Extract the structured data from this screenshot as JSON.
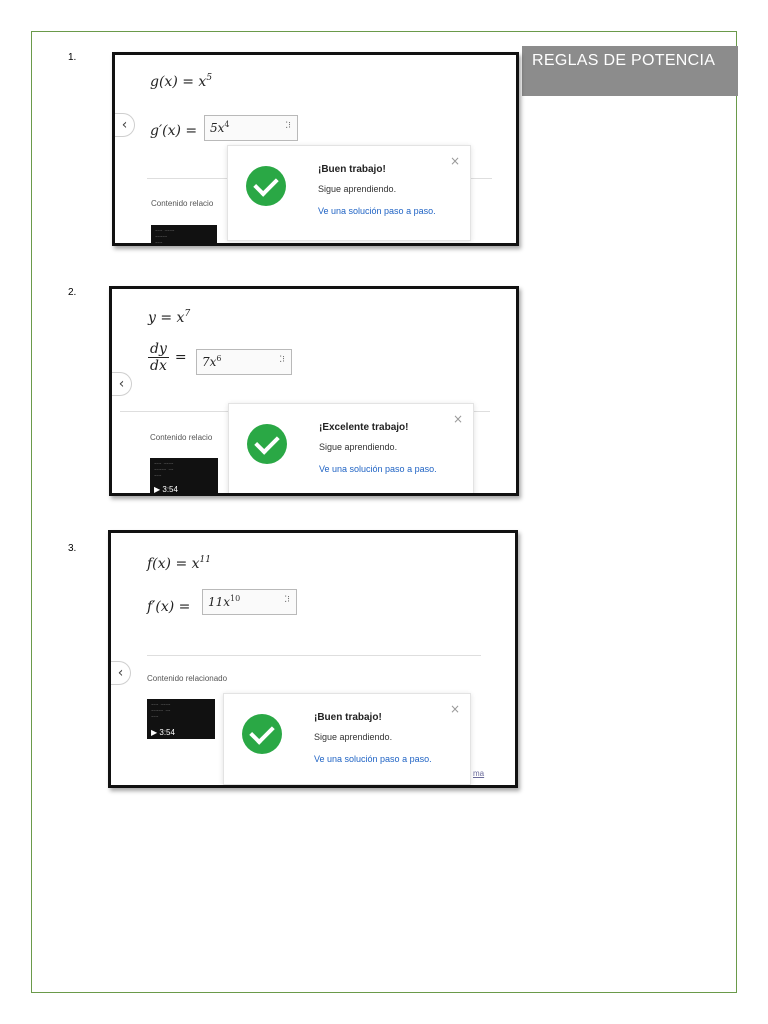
{
  "title": "REGLAS DE POTENCIA",
  "exercises": [
    {
      "number": "1.",
      "function": "g(x) = x",
      "function_exp": "5",
      "derivative_label": "g′(x) =",
      "answer_base": "5x",
      "answer_exp": "4",
      "related": "Contenido relacio",
      "video_duration": "",
      "toast": {
        "title": "¡Buen trabajo!",
        "subtitle": "Sigue aprendiendo.",
        "link": "Ve una solución paso a paso."
      }
    },
    {
      "number": "2.",
      "function": "y = x",
      "function_exp": "7",
      "deriv_num": "dy",
      "deriv_den": "dx",
      "derivative_label": "=",
      "answer_base": "7x",
      "answer_exp": "6",
      "related": "Contenido relacio",
      "video_duration": "▶ 3:54",
      "toast": {
        "title": "¡Excelente trabajo!",
        "subtitle": "Sigue aprendiendo.",
        "link": "Ve una solución paso a paso."
      }
    },
    {
      "number": "3.",
      "function": "f(x) = x",
      "function_exp": "11",
      "derivative_label": "f′(x) =",
      "answer_base": "11x",
      "answer_exp": "10",
      "related": "Contenido relacionado",
      "video_duration": "▶ 3:54",
      "trailing_text": "ma",
      "toast": {
        "title": "¡Buen trabajo!",
        "subtitle": "Sigue aprendiendo.",
        "link": "Ve una solución paso a paso."
      }
    }
  ],
  "icons": {
    "keypad": "keypad-icon",
    "close": "close-icon",
    "back": "chevron-left-icon",
    "check": "check-circle-icon",
    "keypad_glyph": "⁚⁝",
    "close_glyph": "×",
    "back_glyph": "‹"
  },
  "colors": {
    "success": "#2aa845",
    "link": "#1f63c4",
    "title_bg": "#8c8c8c",
    "frame": "#6a9a4a"
  }
}
